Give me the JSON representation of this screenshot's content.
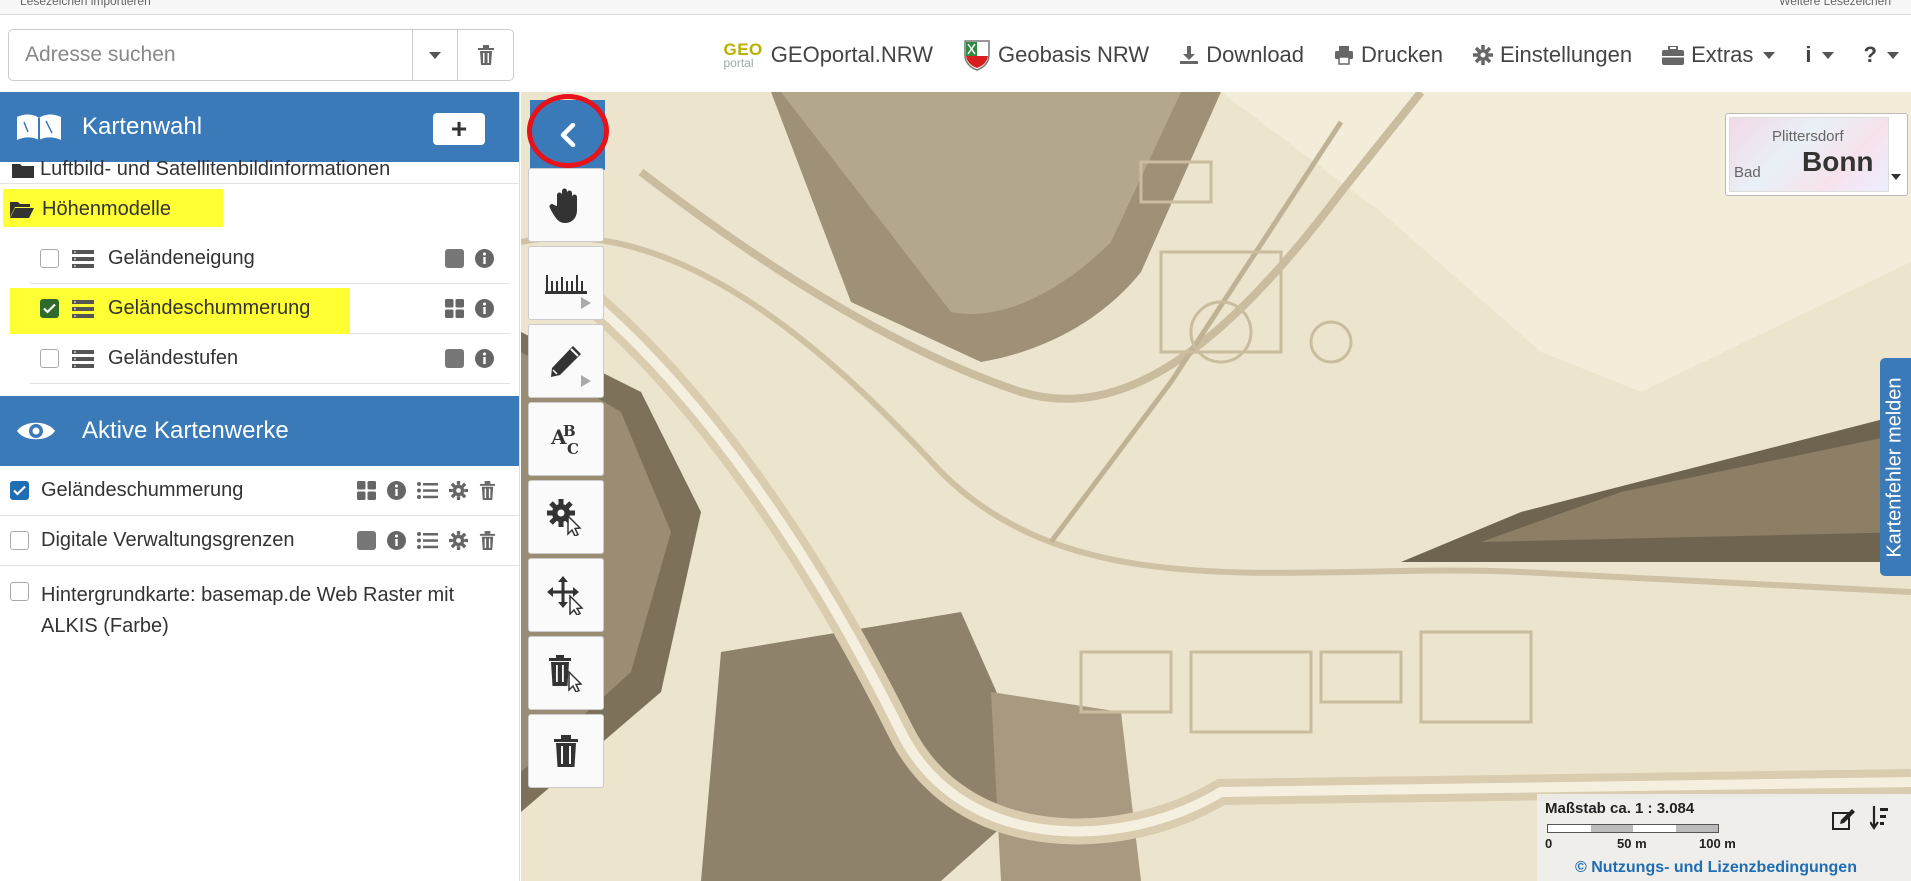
{
  "topstrip": {
    "left": "Lesezeichen importieren",
    "right": "Weitere Lesezeichen"
  },
  "search": {
    "placeholder": "Adresse suchen"
  },
  "nav": {
    "geo_logo_top": "GEO",
    "geo_logo_bottom": "portal",
    "geoportal": "GEOportal.NRW",
    "geobasis": "Geobasis NRW",
    "download": "Download",
    "print": "Drucken",
    "settings": "Einstellungen",
    "extras": "Extras",
    "info": "i",
    "help": "?"
  },
  "kartenwahl": {
    "title": "Kartenwahl",
    "add_label": "+",
    "folder_partial": "Luftbild- und Satellitenbildinformationen",
    "folder": "Höhenmodelle",
    "layers": [
      {
        "label": "Geländeneigung",
        "checked": false
      },
      {
        "label": "Geländeschummerung",
        "checked": true
      },
      {
        "label": "Geländestufen",
        "checked": false
      }
    ]
  },
  "active": {
    "title": "Aktive Kartenwerke",
    "items": [
      {
        "label": "Geländeschummerung",
        "checked": true
      },
      {
        "label": "Digitale Verwaltungsgrenzen",
        "checked": false
      },
      {
        "label": "Hintergrundkarte: basemap.de Web Raster mit ALKIS (Farbe)",
        "checked": false
      }
    ]
  },
  "basemap_thumb": {
    "place1": "Plittersdorf",
    "place2": "Bonn",
    "place3": "Bad"
  },
  "feedback": {
    "label": "Kartenfehler melden"
  },
  "scale": {
    "title": "Maßstab ca. 1 : 3.084",
    "tick0": "0",
    "tick50": "50 m",
    "tick100": "100 m",
    "license": "© Nutzungs- und Lizenzbedingungen"
  },
  "colors": {
    "header_blue": "#3a7ab9",
    "highlight": "#ffff33",
    "ring_red": "#e8121a",
    "map_base": "#e7ddc2"
  },
  "icons": [
    "book-open-icon",
    "eye-icon",
    "hand-icon",
    "ruler-icon",
    "pencil-icon",
    "text-abc-icon",
    "gear-cursor-icon",
    "move-cursor-icon",
    "trash-cursor-icon",
    "trash-icon",
    "chevron-left-icon"
  ]
}
